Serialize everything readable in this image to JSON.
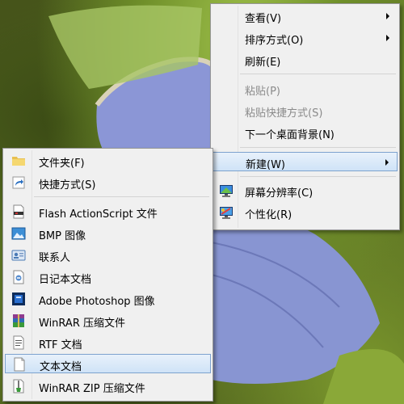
{
  "context_menu": {
    "items": [
      {
        "label": "查看(V)",
        "has_submenu": true,
        "enabled": true
      },
      {
        "label": "排序方式(O)",
        "has_submenu": true,
        "enabled": true
      },
      {
        "label": "刷新(E)",
        "has_submenu": false,
        "enabled": true
      },
      {
        "label": "粘贴(P)",
        "has_submenu": false,
        "enabled": false
      },
      {
        "label": "粘贴快捷方式(S)",
        "has_submenu": false,
        "enabled": false
      },
      {
        "label": "下一个桌面背景(N)",
        "has_submenu": false,
        "enabled": true
      },
      {
        "label": "新建(W)",
        "has_submenu": true,
        "enabled": true,
        "highlighted": true
      },
      {
        "label": "屏幕分辨率(C)",
        "icon": "display-icon",
        "enabled": true
      },
      {
        "label": "个性化(R)",
        "icon": "personalize-icon",
        "enabled": true
      }
    ]
  },
  "new_submenu": {
    "items": [
      {
        "label": "文件夹(F)",
        "icon": "folder-icon"
      },
      {
        "label": "快捷方式(S)",
        "icon": "shortcut-icon"
      },
      {
        "label": "Flash ActionScript 文件",
        "icon": "flash-file-icon"
      },
      {
        "label": "BMP 图像",
        "icon": "bmp-image-icon"
      },
      {
        "label": "联系人",
        "icon": "contact-icon"
      },
      {
        "label": "日记本文档",
        "icon": "journal-icon"
      },
      {
        "label": "Adobe Photoshop 图像",
        "icon": "photoshop-icon"
      },
      {
        "label": "WinRAR 压缩文件",
        "icon": "winrar-icon"
      },
      {
        "label": "RTF 文档",
        "icon": "rtf-doc-icon"
      },
      {
        "label": "文本文档",
        "icon": "text-doc-icon",
        "highlighted": true
      },
      {
        "label": "WinRAR ZIP 压缩文件",
        "icon": "winrar-zip-icon"
      }
    ]
  },
  "colors": {
    "menu_bg": "#f0f0f0",
    "highlight_bg": "#cfe3f7",
    "highlight_border": "#7da2ce",
    "disabled_text": "#8a8a8a"
  }
}
